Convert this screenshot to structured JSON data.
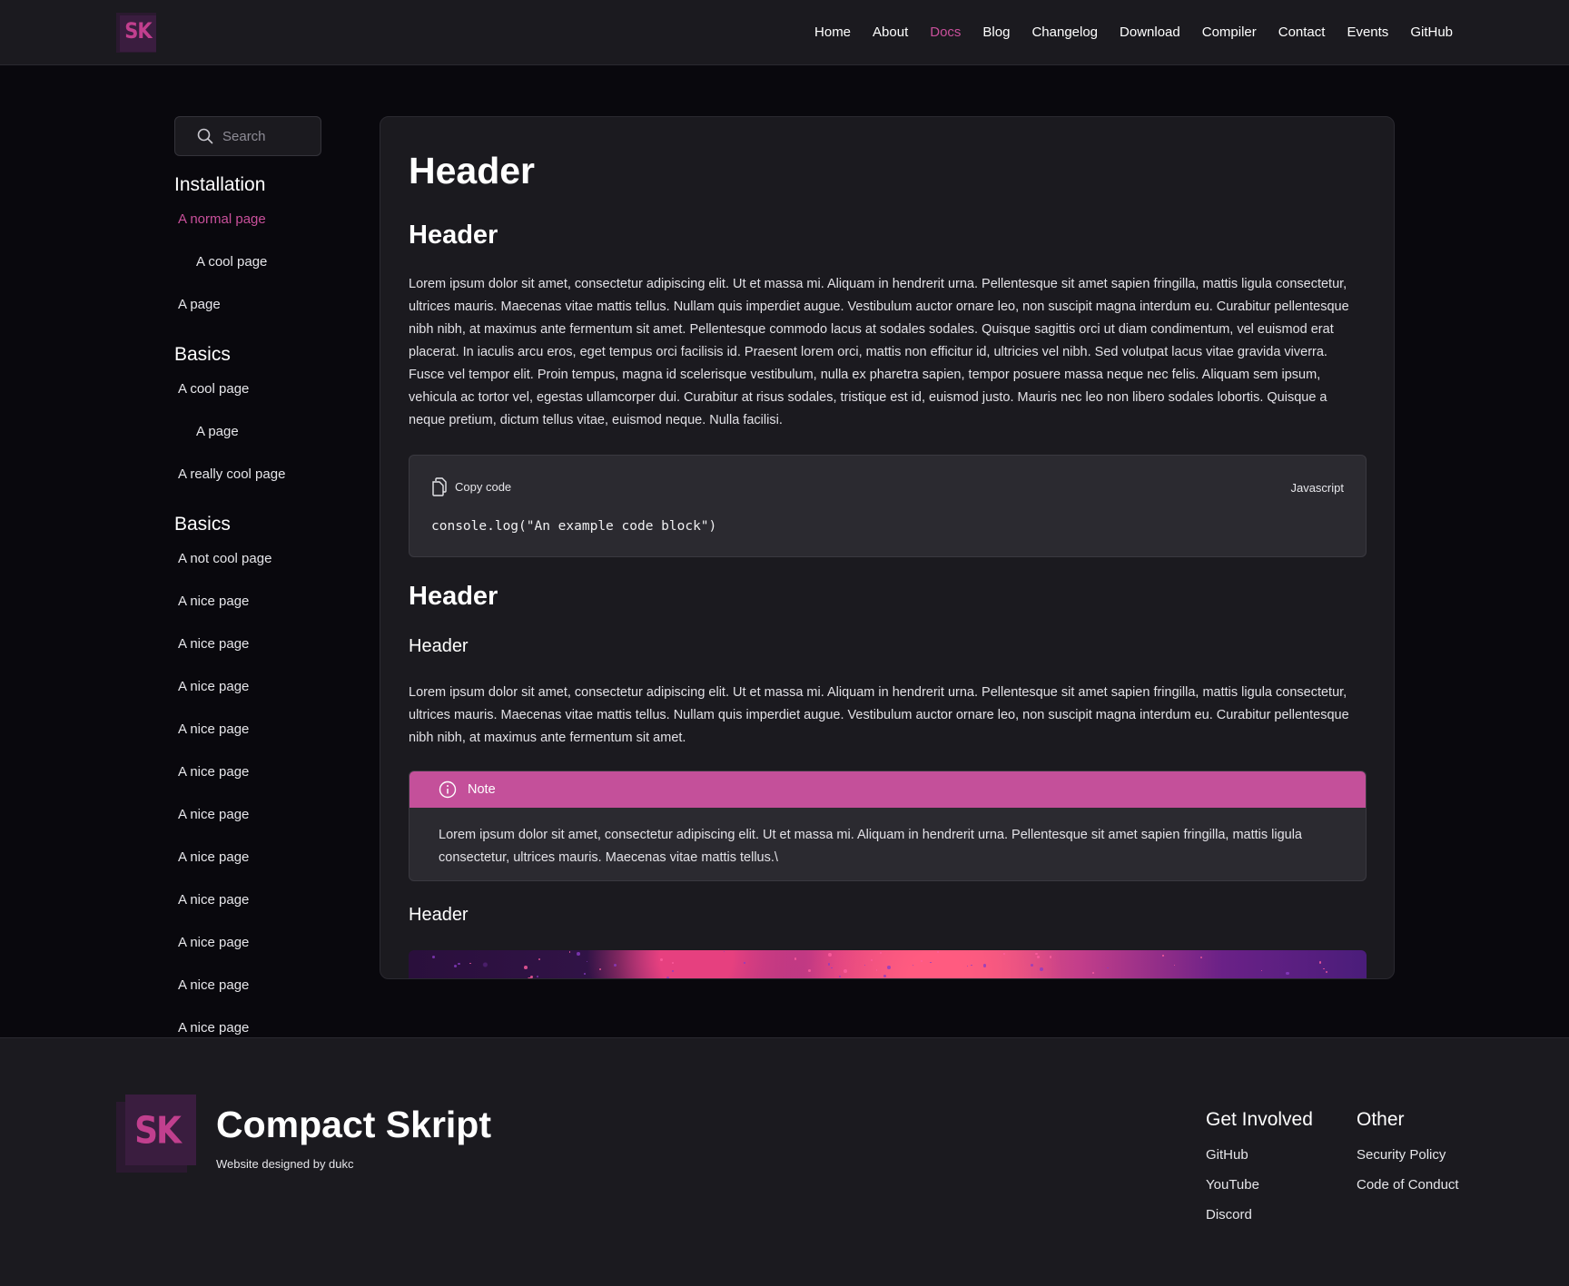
{
  "brand": {
    "logo_text": "SK",
    "name": "Compact Skript",
    "tagline": "Website designed by dukc"
  },
  "nav": [
    {
      "label": "Home",
      "active": false
    },
    {
      "label": "About",
      "active": false
    },
    {
      "label": "Docs",
      "active": true
    },
    {
      "label": "Blog",
      "active": false
    },
    {
      "label": "Changelog",
      "active": false
    },
    {
      "label": "Download",
      "active": false
    },
    {
      "label": "Compiler",
      "active": false
    },
    {
      "label": "Contact",
      "active": false
    },
    {
      "label": "Events",
      "active": false
    },
    {
      "label": "GitHub",
      "active": false
    }
  ],
  "sidebar": {
    "search_placeholder": "Search",
    "groups": [
      {
        "title": "Installation",
        "items": [
          {
            "label": "A normal page",
            "indent": false,
            "active": true
          },
          {
            "label": "A cool page",
            "indent": true,
            "active": false
          },
          {
            "label": "A page",
            "indent": false,
            "active": false
          }
        ]
      },
      {
        "title": "Basics",
        "items": [
          {
            "label": "A cool page",
            "indent": false,
            "active": false
          },
          {
            "label": "A page",
            "indent": true,
            "active": false
          },
          {
            "label": "A really cool page",
            "indent": false,
            "active": false
          }
        ]
      },
      {
        "title": "Basics",
        "items": [
          {
            "label": "A not cool page",
            "indent": false,
            "active": false
          },
          {
            "label": "A nice page",
            "indent": false,
            "active": false
          },
          {
            "label": "A nice page",
            "indent": false,
            "active": false
          },
          {
            "label": "A nice page",
            "indent": false,
            "active": false
          },
          {
            "label": "A nice page",
            "indent": false,
            "active": false
          },
          {
            "label": "A nice page",
            "indent": false,
            "active": false
          },
          {
            "label": "A nice page",
            "indent": false,
            "active": false
          },
          {
            "label": "A nice page",
            "indent": false,
            "active": false
          },
          {
            "label": "A nice page",
            "indent": false,
            "active": false
          },
          {
            "label": "A nice page",
            "indent": false,
            "active": false
          },
          {
            "label": "A nice page",
            "indent": false,
            "active": false
          },
          {
            "label": "A nice page",
            "indent": false,
            "active": false
          }
        ]
      }
    ]
  },
  "content": {
    "h1": "Header",
    "h2_first": "Header",
    "para1": "Lorem ipsum dolor sit amet, consectetur adipiscing elit. Ut et massa mi. Aliquam in hendrerit urna. Pellentesque sit amet sapien fringilla, mattis ligula consectetur, ultrices mauris. Maecenas vitae mattis tellus. Nullam quis imperdiet augue. Vestibulum auctor ornare leo, non suscipit magna interdum eu. Curabitur pellentesque nibh nibh, at maximus ante fermentum sit amet. Pellentesque commodo lacus at sodales sodales. Quisque sagittis orci ut diam condimentum, vel euismod erat placerat. In iaculis arcu eros, eget tempus orci facilisis id. Praesent lorem orci, mattis non efficitur id, ultricies vel nibh. Sed volutpat lacus vitae gravida viverra. Fusce vel tempor elit. Proin tempus, magna id scelerisque vestibulum, nulla ex pharetra sapien, tempor posuere massa neque nec felis. Aliquam sem ipsum, vehicula ac tortor vel, egestas ullamcorper dui. Curabitur at risus sodales, tristique est id, euismod justo. Mauris nec leo non libero sodales lobortis. Quisque a neque pretium, dictum tellus vitae, euismod neque. Nulla facilisi.",
    "code": {
      "copy_label": "Copy code",
      "language": "Javascript",
      "line": "console.log(\"An example code block\")"
    },
    "h2_second": "Header",
    "h3_first": "Header",
    "para2": "Lorem ipsum dolor sit amet, consectetur adipiscing elit. Ut et massa mi. Aliquam in hendrerit urna. Pellentesque sit amet sapien fringilla, mattis ligula consectetur, ultrices mauris. Maecenas vitae mattis tellus. Nullam quis imperdiet augue. Vestibulum auctor ornare leo, non suscipit magna interdum eu. Curabitur pellentesque nibh nibh, at maximus ante fermentum sit amet.",
    "note": {
      "title": "Note",
      "body": "Lorem ipsum dolor sit amet, consectetur adipiscing elit. Ut et massa mi. Aliquam in hendrerit urna. Pellentesque sit amet sapien fringilla, mattis ligula consectetur, ultrices mauris. Maecenas vitae mattis tellus.\\"
    },
    "h3_second": "Header"
  },
  "footer": {
    "columns": [
      {
        "title": "Get Involved",
        "links": [
          "GitHub",
          "YouTube",
          "Discord"
        ]
      },
      {
        "title": "Other",
        "links": [
          "Security Policy",
          "Code of Conduct"
        ]
      }
    ]
  },
  "colors": {
    "accent": "#c9509b",
    "note_header": "#c4509a",
    "background": "#09080d",
    "panel": "#1b1a1f"
  },
  "icons": {
    "search": "search-icon",
    "copy": "copy-icon",
    "info": "info-icon"
  }
}
